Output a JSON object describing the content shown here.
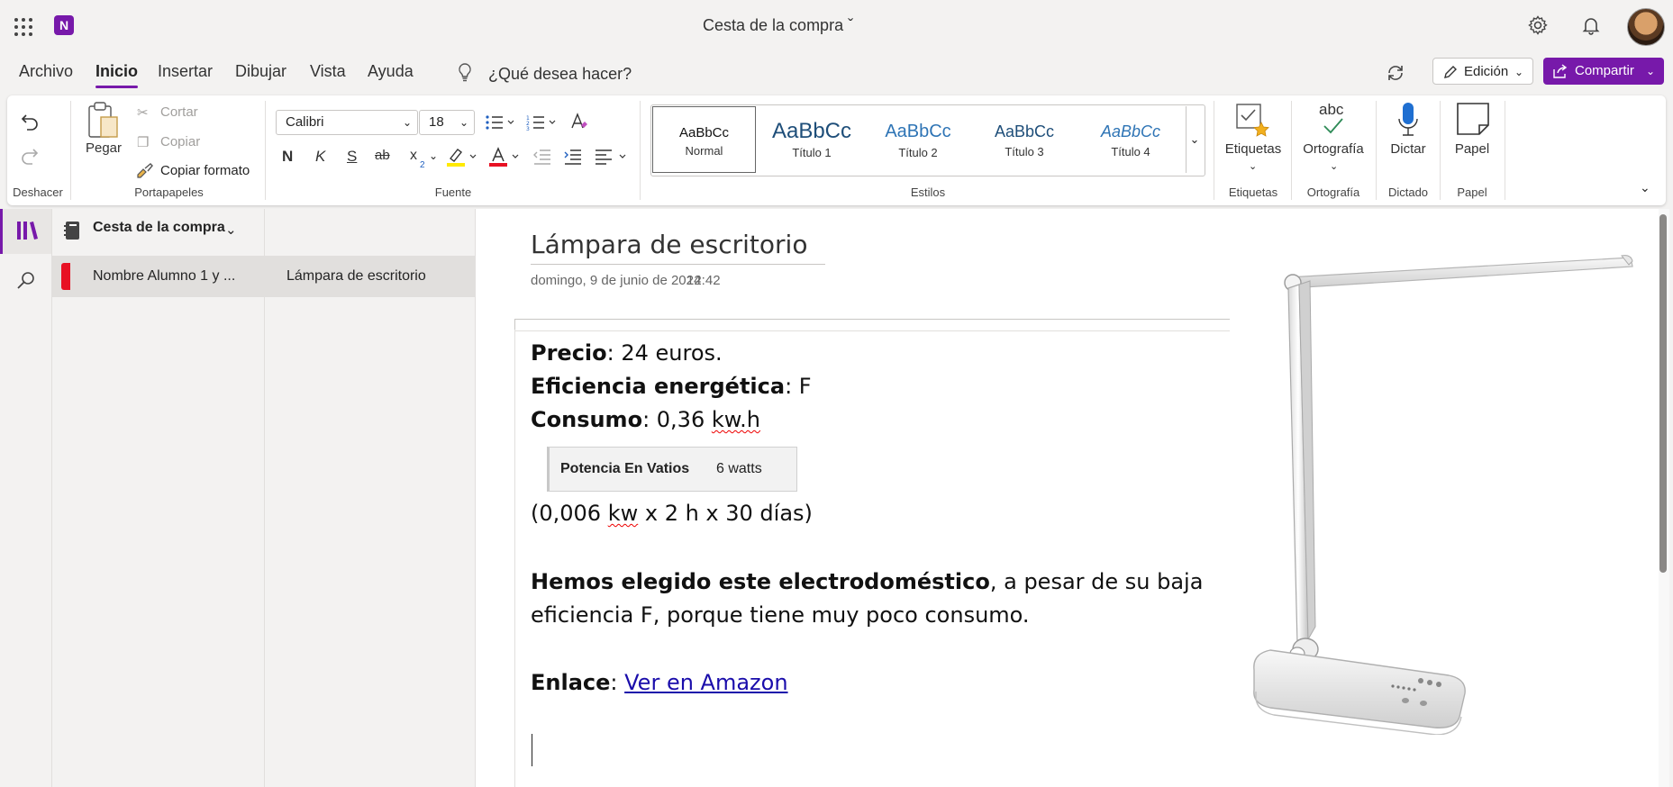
{
  "titlebar": {
    "doc_title": "Cesta de la compra ˇ",
    "app_icon": "onenote-icon",
    "app_letter": "N"
  },
  "menu": {
    "tabs": [
      "Archivo",
      "Inicio",
      "Insertar",
      "Dibujar",
      "Vista",
      "Ayuda"
    ],
    "active_tab": "Inicio",
    "search_hint": "¿Qué desea hacer?",
    "edit_label": "Edición",
    "share_label": "Compartir"
  },
  "ribbon": {
    "undo_group": "Deshacer",
    "clipboard": {
      "paste": "Pegar",
      "cut": "Cortar",
      "copy": "Copiar",
      "format_painter": "Copiar formato",
      "group": "Portapapeles"
    },
    "font": {
      "family": "Calibri",
      "size": "18",
      "group": "Fuente",
      "bold": "N",
      "italic": "K",
      "underline": "S",
      "strike": "ab",
      "subscript": "x"
    },
    "styles": {
      "group": "Estilos",
      "items": [
        {
          "sample": "AaBbCc",
          "name": "Normal"
        },
        {
          "sample": "AaBbCc",
          "name": "Título 1"
        },
        {
          "sample": "AaBbCc",
          "name": "Título 2"
        },
        {
          "sample": "AaBbCc",
          "name": "Título 3"
        },
        {
          "sample": "AaBbCc",
          "name": "Título 4"
        }
      ]
    },
    "tags": {
      "label": "Etiquetas",
      "group": "Etiquetas"
    },
    "spelling": {
      "label": "Ortografía",
      "group": "Ortografía",
      "icon_text": "abc"
    },
    "dictate": {
      "label": "Dictar",
      "group": "Dictado"
    },
    "paper": {
      "label": "Papel",
      "group": "Papel"
    }
  },
  "navigation": {
    "notebook": "Cesta de la compra",
    "section": "Nombre Alumno 1 y ...",
    "page": "Lámpara de escritorio"
  },
  "page": {
    "title": "Lámpara de escritorio",
    "date": "domingo, 9 de junio de 2024",
    "time": "12:42",
    "price_label": "Precio",
    "price_value": ": 24 euros.",
    "efficiency_label": "Eficiencia energética",
    "efficiency_value": ": F",
    "consumption_label": "Consumo",
    "consumption_value_prefix": ": 0,36 ",
    "consumption_unit": "kw.h",
    "table_key": "Potencia En Vatios",
    "table_value": "6 watts",
    "calc_open": "(0,006 ",
    "calc_kw": "kw",
    "calc_rest": " x 2 h x 30 días)",
    "reason_bold": "Hemos elegido este electrodoméstico",
    "reason_rest_1": ", a pesar de su baja",
    "reason_rest_2": "eficiencia F, porque tiene muy poco consumo.",
    "link_label": "Enlace",
    "link_sep": ": ",
    "link_text": "Ver en Amazon"
  },
  "colors": {
    "accent": "#7719aa",
    "section_tab": "#e81123",
    "link": "#1a0dab"
  }
}
